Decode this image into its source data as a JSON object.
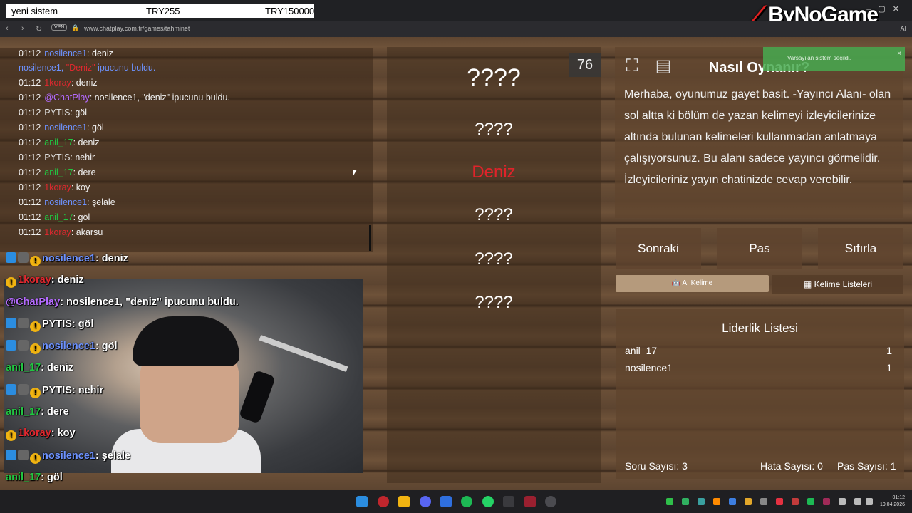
{
  "stream_bar": {
    "label": "yeni sistem",
    "amount1": "TRY255",
    "amount2": "TRY150000"
  },
  "brand": {
    "logo_text": "ByNoGame"
  },
  "browser": {
    "vpn": "VPN",
    "url": "www.chatplay.com.tr/games/tahminet",
    "ai_tag": "AI"
  },
  "chat_log": [
    {
      "time": "01:12",
      "user": "nosilence1",
      "msg": ": deniz",
      "color": "blue"
    },
    {
      "time": "",
      "user": "nosilence1, ",
      "highlight": "\"Deniz\"",
      "msg": " ipucunu buldu.",
      "color": "blue"
    },
    {
      "time": "01:12",
      "user": "1koray",
      "msg": ": deniz",
      "color": "red"
    },
    {
      "time": "01:12",
      "user": "@ChatPlay",
      "msg": ": nosilence1, \"deniz\" ipucunu buldu.",
      "color": "purple"
    },
    {
      "time": "01:12",
      "user": "PYTIS",
      "msg": ": göl",
      "color": "gray"
    },
    {
      "time": "01:12",
      "user": "nosilence1",
      "msg": ": göl",
      "color": "blue"
    },
    {
      "time": "01:12",
      "user": "anil_17",
      "msg": ": deniz",
      "color": "green"
    },
    {
      "time": "01:12",
      "user": "PYTIS",
      "msg": ": nehir",
      "color": "gray"
    },
    {
      "time": "01:12",
      "user": "anil_17",
      "msg": ": dere",
      "color": "green"
    },
    {
      "time": "01:12",
      "user": "1koray",
      "msg": ": koy",
      "color": "red"
    },
    {
      "time": "01:12",
      "user": "nosilence1",
      "msg": ": şelale",
      "color": "blue"
    },
    {
      "time": "01:12",
      "user": "anil_17",
      "msg": ": göl",
      "color": "green"
    },
    {
      "time": "01:12",
      "user": "1koray",
      "msg": ": akarsu",
      "color": "red"
    }
  ],
  "words": {
    "timer": "76",
    "items": [
      "????",
      "????",
      "Deniz",
      "????",
      "????",
      "????"
    ]
  },
  "howto": {
    "title": "Nasıl Oynanır?",
    "text": "Merhaba, oyunumuz gayet basit. -Yayıncı Alanı- olan sol altta ki bölüm de yazan kelimeyi izleyicilerinize altında bulunan kelimeleri kullanmadan anlatmaya çalışıyorsunuz. Bu alanı sadece yayıncı görmelidir. İzleyicileriniz yayın chatinizde cevap verebilir."
  },
  "toast": {
    "message": "Varsayılan sistem seçildi.",
    "close": "×"
  },
  "controls": {
    "next": "Sonraki",
    "pass": "Pas",
    "reset": "Sıfırla",
    "ai_word": "AI Kelime",
    "word_lists": "Kelime Listeleri"
  },
  "leaderboard": {
    "title": "Liderlik Listesi",
    "rows": [
      {
        "name": "anil_17",
        "score": "1"
      },
      {
        "name": "nosilence1",
        "score": "1"
      }
    ],
    "question_count": "Soru Sayısı: 3",
    "error_count": "Hata Sayısı: 0",
    "pass_count": "Pas Sayısı: 1"
  },
  "overlay_chat": [
    {
      "user": "nosilence1",
      "msg": ": deniz",
      "badges": 3,
      "color": "#6d92ff"
    },
    {
      "user": "1koray",
      "msg": ": deniz",
      "badges": 1,
      "color": "#e0282f"
    },
    {
      "user": "@ChatPlay",
      "msg": ": nosilence1, \"deniz\" ipucunu buldu.",
      "badges": 0,
      "color": "#b56bff"
    },
    {
      "user": "PYTIS",
      "msg": ": göl",
      "badges": 3,
      "color": "#ffffff"
    },
    {
      "user": "nosilence1",
      "msg": ": göl",
      "badges": 3,
      "color": "#6d92ff"
    },
    {
      "user": "anil_17",
      "msg": ": deniz",
      "badges": 0,
      "color": "#22c542"
    },
    {
      "user": "PYTIS",
      "msg": ": nehir",
      "badges": 3,
      "color": "#ffffff"
    },
    {
      "user": "anil_17",
      "msg": ": dere",
      "badges": 0,
      "color": "#22c542"
    },
    {
      "user": "1koray",
      "msg": ": koy",
      "badges": 1,
      "color": "#e0282f"
    },
    {
      "user": "nosilence1",
      "msg": ": şelale",
      "badges": 3,
      "color": "#6d92ff"
    },
    {
      "user": "anil_17",
      "msg": ": göl",
      "badges": 0,
      "color": "#22c542"
    },
    {
      "user": "1koray",
      "msg": ": akarsu",
      "badges": 1,
      "color": "#e0282f"
    }
  ],
  "taskbar": {
    "time": "01:12",
    "date": "19.04.2026"
  }
}
